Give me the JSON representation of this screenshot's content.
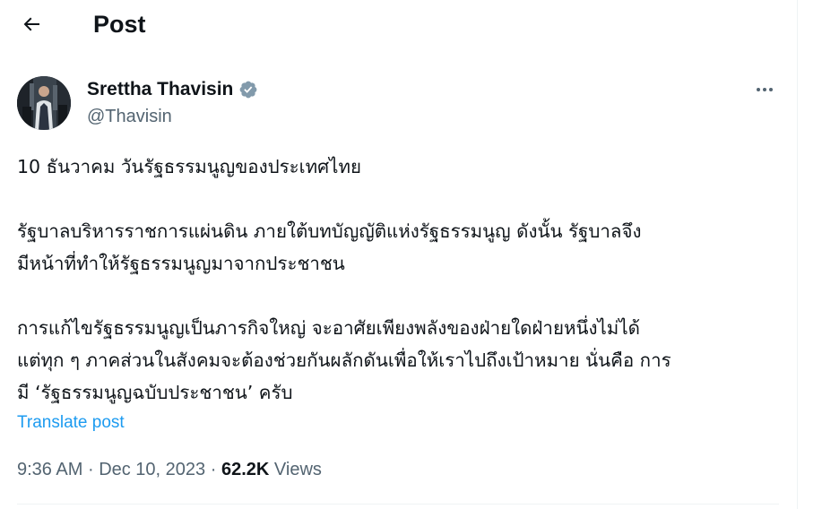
{
  "header": {
    "back_icon": "arrow-left-icon",
    "title": "Post"
  },
  "author": {
    "display_name": "Srettha Thavisin",
    "handle": "@Thavisin",
    "verified_icon": "verified-badge-icon",
    "verified_color": "#1d9bf0",
    "more_icon": "more-horizontal-icon"
  },
  "post": {
    "paragraphs": [
      [
        "10 ธันวาคม วันรัฐธรรมนูญของประเทศไทย"
      ],
      [
        "รัฐบาลบริหารราชการแผ่นดิน ภายใต้บทบัญญัติแห่งรัฐธรรมนูญ ดังนั้น รัฐบาลจึง",
        "มีหน้าที่ทำให้รัฐธรรมนูญมาจากประชาชน"
      ],
      [
        "การแก้ไขรัฐธรรมนูญเป็นภารกิจใหญ่ จะอาศัยเพียงพลังของฝ่ายใดฝ่ายหนึ่งไม่ได้",
        "แต่ทุก ๆ ภาคส่วนในสังคมจะต้องช่วยกันผลักดันเพื่อให้เราไปถึงเป้าหมาย นั่นคือ การ",
        "มี ‘รัฐธรรมนูญฉบับประชาชน’ ครับ"
      ]
    ],
    "translate_label": "Translate post"
  },
  "meta": {
    "time": "9:36 AM",
    "separator": "·",
    "date": "Dec 10, 2023",
    "views_count": "62.2K",
    "views_label": "Views"
  },
  "colors": {
    "text_primary": "#0f1419",
    "text_secondary": "#536471",
    "link": "#1d9bf0",
    "divider": "#eff3f4"
  }
}
